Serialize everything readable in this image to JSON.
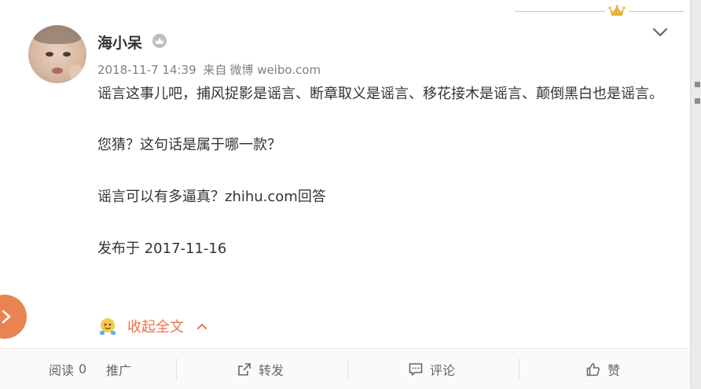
{
  "post": {
    "author": "海小呆",
    "timestamp": "2018-11-7 14:39",
    "source_prefix": "来自",
    "source": "微博 weibo.com",
    "paragraphs": [
      "谣言这事儿吧，捕风捉影是谣言、断章取义是谣言、移花接木是谣言、颠倒黑白也是谣言。",
      "您猜？这句话是属于哪一款？",
      "谣言可以有多逼真？zhihu.com回答",
      "发布于 2017-11-16"
    ],
    "collapse_label": "收起全文"
  },
  "footer": {
    "read_label": "阅读",
    "read_count": "0",
    "promote_label": "推广",
    "forward_label": "转发",
    "comment_label": "评论",
    "like_label": "赞"
  },
  "icons": {
    "vip": "vip-crown-icon",
    "dropdown": "chevron-down-icon",
    "decor": "gold-crown-icon",
    "collapse": "emoji-face-icon",
    "collapse_arrow": "chevron-up-icon",
    "side": "chevron-right-icon",
    "forward": "forward-icon",
    "comment": "comment-icon",
    "like": "thumbs-up-icon"
  },
  "colors": {
    "accent": "#eb7350",
    "side_button": "#e9834f",
    "gold": "#e8c86a",
    "text": "#333333",
    "meta": "#808080"
  }
}
